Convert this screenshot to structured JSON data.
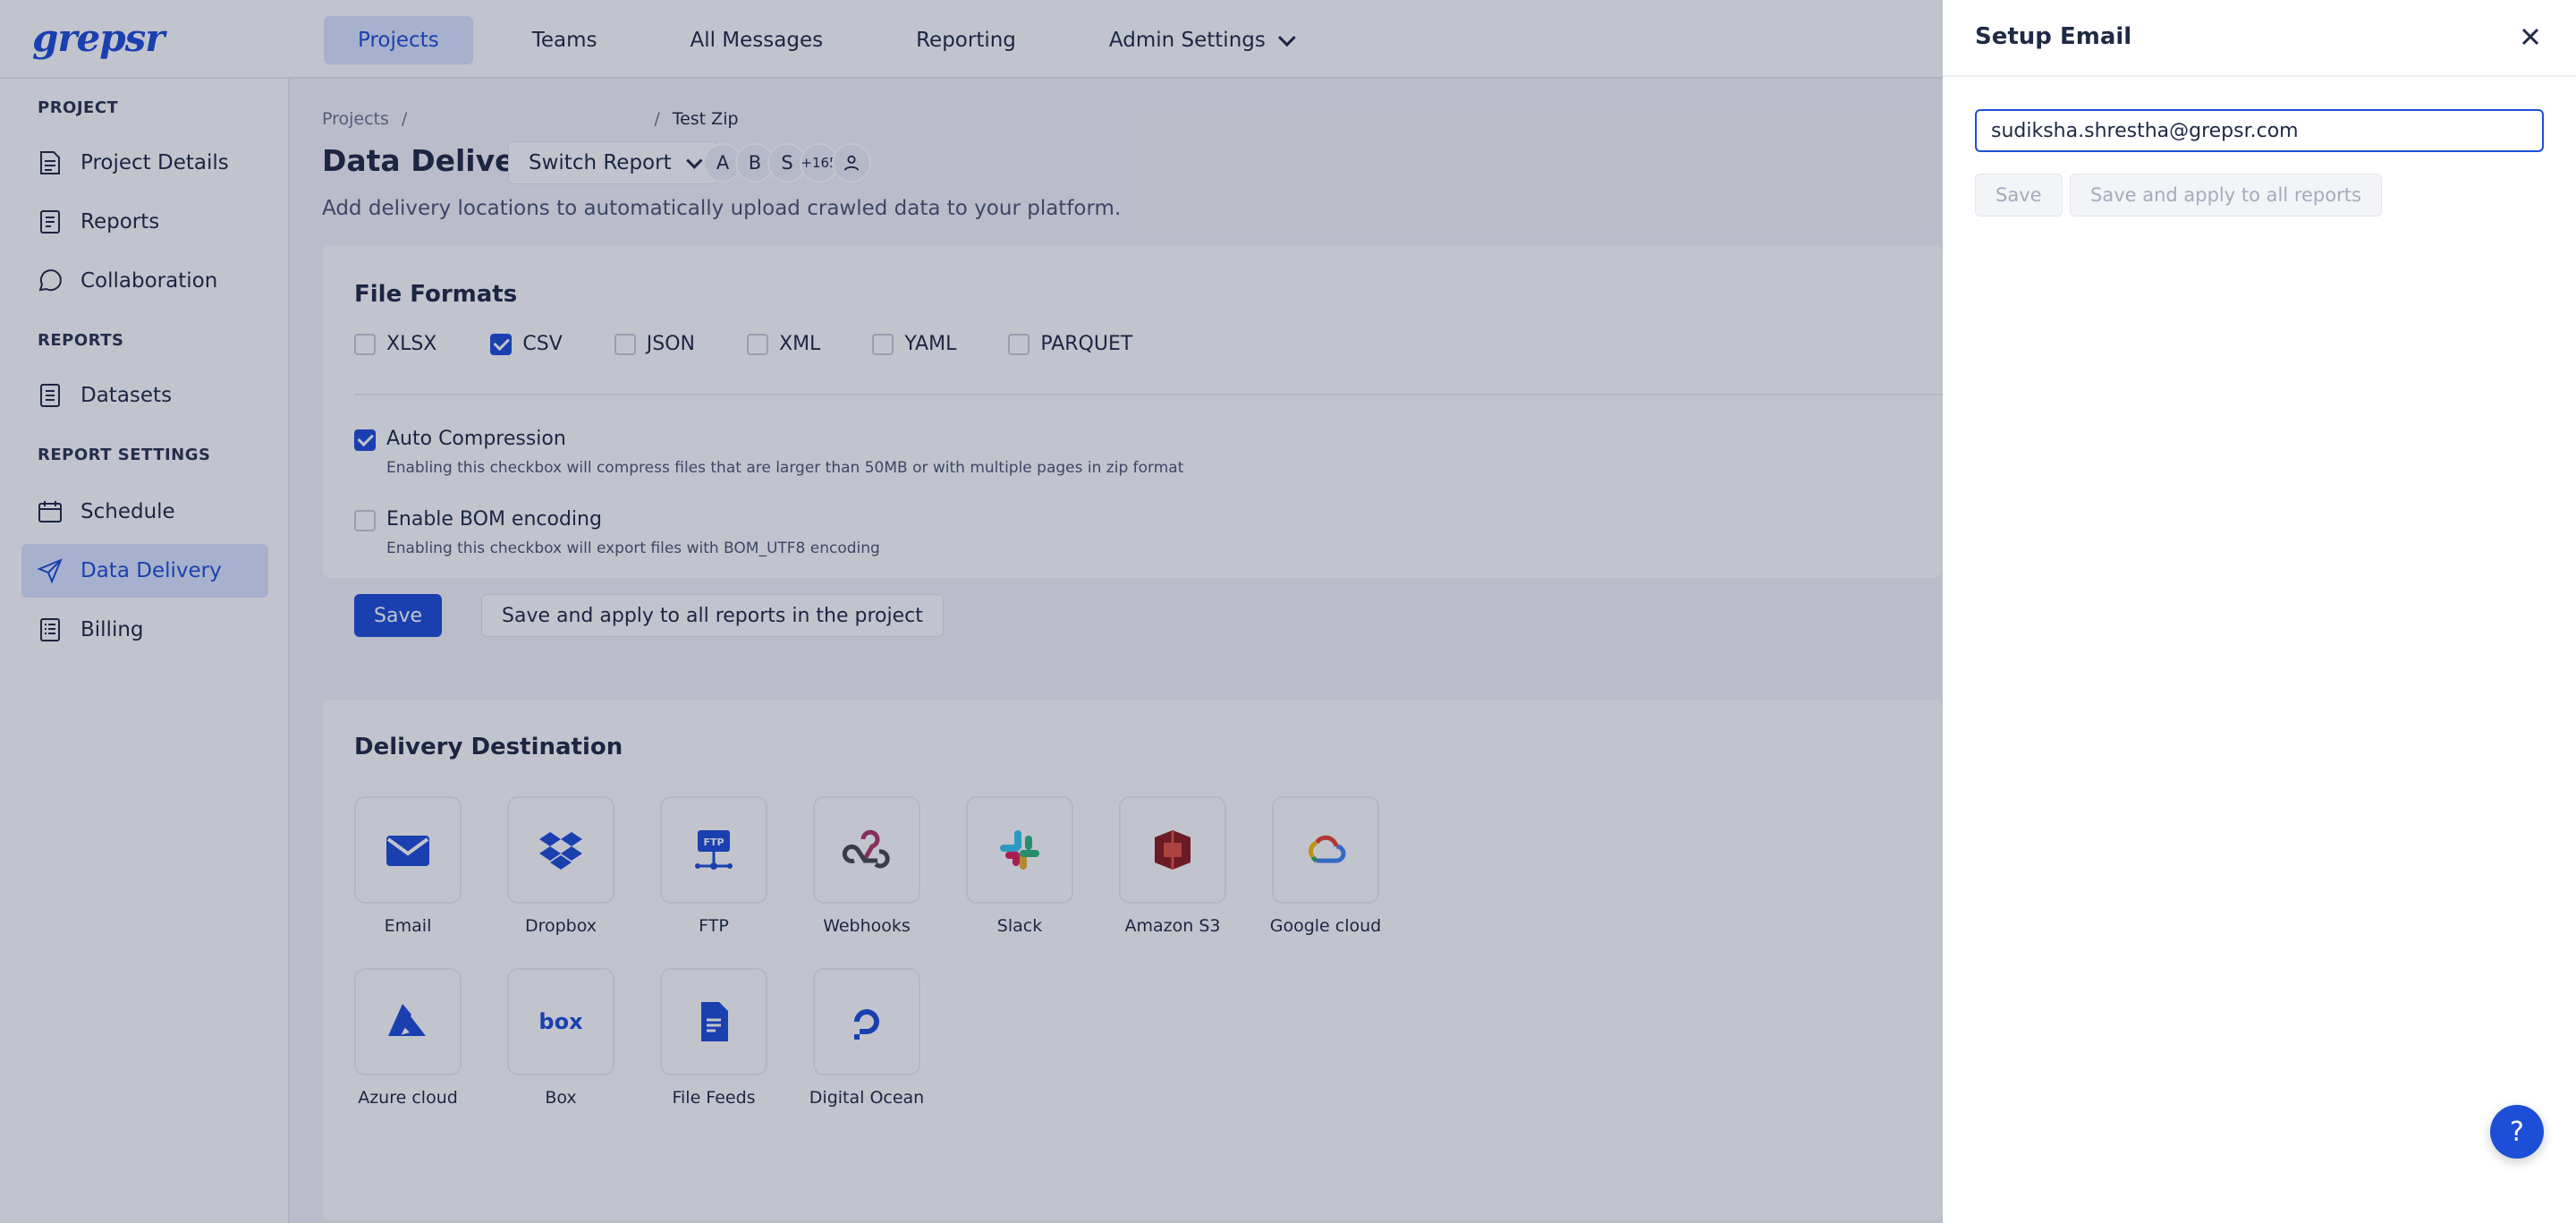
{
  "app": {
    "logo": "grepsr"
  },
  "nav": [
    {
      "label": "Projects",
      "active": true
    },
    {
      "label": "Teams"
    },
    {
      "label": "All Messages"
    },
    {
      "label": "Reporting"
    },
    {
      "label": "Admin Settings",
      "dropdown": true
    }
  ],
  "sidebar": {
    "sections": [
      {
        "title": "PROJECT",
        "items": [
          {
            "label": "Project Details",
            "icon": "project-details-icon"
          },
          {
            "label": "Reports",
            "icon": "reports-icon"
          },
          {
            "label": "Collaboration",
            "icon": "collaboration-icon"
          }
        ]
      },
      {
        "title": "REPORTS",
        "items": [
          {
            "label": "Datasets",
            "icon": "datasets-icon"
          }
        ]
      },
      {
        "title": "REPORT SETTINGS",
        "items": [
          {
            "label": "Schedule",
            "icon": "schedule-icon"
          },
          {
            "label": "Data Delivery",
            "icon": "send-icon",
            "active": true
          },
          {
            "label": "Billing",
            "icon": "billing-icon"
          }
        ]
      }
    ]
  },
  "breadcrumb": {
    "root": "Projects",
    "sep": "/",
    "current": "Test Zip"
  },
  "page": {
    "title": "Data Delivery",
    "switch_report": "Switch Report",
    "avatars": [
      "A",
      "B",
      "S",
      "+165"
    ],
    "subtitle": "Add delivery locations to automatically upload crawled data to your platform."
  },
  "file_formats": {
    "title": "File Formats",
    "formats": [
      {
        "label": "XLSX",
        "checked": false
      },
      {
        "label": "CSV",
        "checked": true
      },
      {
        "label": "JSON",
        "checked": false
      },
      {
        "label": "XML",
        "checked": false
      },
      {
        "label": "YAML",
        "checked": false
      },
      {
        "label": "PARQUET",
        "checked": false
      }
    ],
    "auto_compression": {
      "label": "Auto Compression",
      "desc": "Enabling this checkbox will compress files that are larger than 50MB or with multiple pages in zip format",
      "checked": true
    },
    "bom": {
      "label": "Enable BOM encoding",
      "desc": "Enabling this checkbox will export files with BOM_UTF8 encoding",
      "checked": false
    },
    "save": "Save",
    "save_all": "Save and apply to all reports in the project"
  },
  "delivery": {
    "title": "Delivery Destination",
    "destinations": [
      {
        "label": "Email",
        "icon": "email-icon"
      },
      {
        "label": "Dropbox",
        "icon": "dropbox-icon"
      },
      {
        "label": "FTP",
        "icon": "ftp-icon"
      },
      {
        "label": "Webhooks",
        "icon": "webhooks-icon"
      },
      {
        "label": "Slack",
        "icon": "slack-icon"
      },
      {
        "label": "Amazon S3",
        "icon": "amazon-s3-icon"
      },
      {
        "label": "Google cloud",
        "icon": "google-cloud-icon"
      },
      {
        "label": "Azure cloud",
        "icon": "azure-cloud-icon"
      },
      {
        "label": "Box",
        "icon": "box-icon"
      },
      {
        "label": "File Feeds",
        "icon": "file-feeds-icon"
      },
      {
        "label": "Digital Ocean",
        "icon": "digital-ocean-icon"
      }
    ]
  },
  "drawer": {
    "title": "Setup Email",
    "email_value": "sudiksha.shrestha@grepsr.com",
    "save": "Save",
    "save_all": "Save and apply to all reports"
  },
  "help": {
    "label": "?"
  },
  "colors": {
    "accent": "#1d4ed8",
    "accent_light": "#dbe6ff"
  }
}
